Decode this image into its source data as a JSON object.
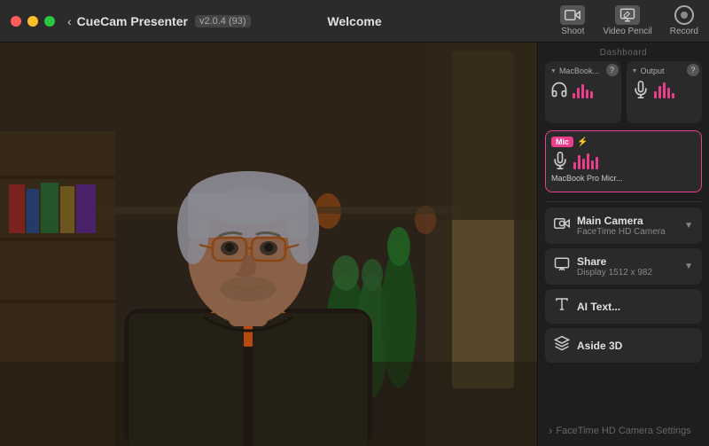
{
  "app": {
    "title": "CueCam Presenter",
    "version": "v2.0.4 (93)",
    "page": "Welcome",
    "back_label": "‹"
  },
  "titlebar": {
    "buttons": [
      {
        "id": "shoot",
        "label": "Shoot",
        "icon": "📷"
      },
      {
        "id": "video-pencil",
        "label": "Video Pencil",
        "icon": "✏️"
      },
      {
        "id": "record",
        "label": "Record",
        "icon": ""
      }
    ]
  },
  "dashboard": {
    "label": "Dashboard",
    "audio_cards": [
      {
        "id": "macbook",
        "label": "MacBook...",
        "type": "output",
        "active": false
      },
      {
        "id": "output",
        "label": "Output",
        "type": "output",
        "active": false
      }
    ],
    "mic_card": {
      "tag": "Mic",
      "name": "MacBook Pro Micr...",
      "active": true
    }
  },
  "sources": [
    {
      "id": "main-camera",
      "name": "Main Camera",
      "sub": "FaceTime HD Camera",
      "icon": "camera"
    },
    {
      "id": "share",
      "name": "Share",
      "sub": "Display 1512 x 982",
      "icon": "monitor"
    },
    {
      "id": "text",
      "name": "Text...",
      "sub": "",
      "icon": "text"
    },
    {
      "id": "aside-3d",
      "name": "Aside 3D",
      "sub": "",
      "icon": "aside"
    }
  ],
  "settings_link": "FaceTime HD Camera Settings",
  "colors": {
    "accent_pink": "#e83e8c",
    "bg_dark": "#1e1e1e",
    "bg_card": "#2a2a2a",
    "text_muted": "#888888"
  }
}
